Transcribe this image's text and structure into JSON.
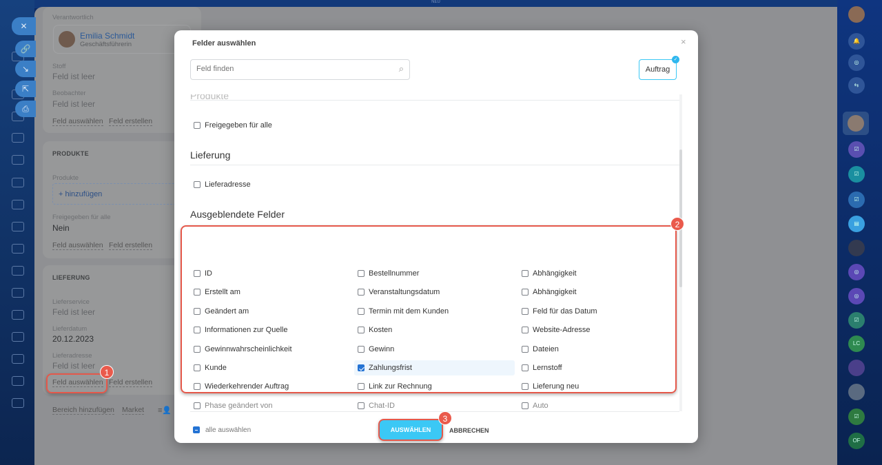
{
  "topbar": {
    "label": "NEU"
  },
  "floating_actions": [
    "close-icon",
    "link-icon",
    "download-icon",
    "external-icon",
    "print-icon"
  ],
  "detail": {
    "responsible_label": "Verantwortlich",
    "responsible_name": "Emilia Schmidt",
    "responsible_role": "Geschäftsführerin",
    "fields1": [
      {
        "label": "Stoff",
        "value": "Feld ist leer"
      },
      {
        "label": "Beobachter",
        "value": "Feld ist leer"
      }
    ],
    "select_field": "Feld auswählen",
    "create_field": "Feld erstellen",
    "products_section": "PRODUKTE",
    "products_label": "Produkte",
    "add_label": "+ hinzufügen",
    "shared_label": "Freigegeben für alle",
    "shared_value": "Nein",
    "delivery_section": "LIEFERUNG",
    "delivery_fields": [
      {
        "label": "Lieferservice",
        "value": "Feld ist leer"
      },
      {
        "label": "Lieferdatum",
        "value": "20.12.2023"
      },
      {
        "label": "Lieferadresse",
        "value": "Feld ist leer"
      }
    ],
    "add_area": "Bereich hinzufügen",
    "market": "Market"
  },
  "modal": {
    "title": "Felder auswählen",
    "search_placeholder": "Feld finden",
    "entity_button": "Auftrag",
    "cut_section": "Produkte",
    "products_items": [
      {
        "label": "Freigegeben für alle",
        "checked": false
      }
    ],
    "delivery_title": "Lieferung",
    "delivery_items": [
      {
        "label": "Lieferadresse",
        "checked": false
      }
    ],
    "hidden_title": "Ausgeblendete Felder",
    "hidden_items": [
      [
        {
          "label": "ID",
          "checked": false
        },
        {
          "label": "Bestellnummer",
          "checked": false
        },
        {
          "label": "Abhängigkeit",
          "checked": false
        }
      ],
      [
        {
          "label": "Erstellt am",
          "checked": false
        },
        {
          "label": "Veranstaltungsdatum",
          "checked": false
        },
        {
          "label": "Abhängigkeit",
          "checked": false
        }
      ],
      [
        {
          "label": "Geändert am",
          "checked": false
        },
        {
          "label": "Termin mit dem Kunden",
          "checked": false
        },
        {
          "label": "Feld für das Datum",
          "checked": false
        }
      ],
      [
        {
          "label": "Informationen zur Quelle",
          "checked": false
        },
        {
          "label": "Kosten",
          "checked": false
        },
        {
          "label": "Website-Adresse",
          "checked": false
        }
      ],
      [
        {
          "label": "Gewinnwahrscheinlichkeit",
          "checked": false
        },
        {
          "label": "Gewinn",
          "checked": false
        },
        {
          "label": "Dateien",
          "checked": false
        }
      ],
      [
        {
          "label": "Kunde",
          "checked": false
        },
        {
          "label": "Zahlungsfrist",
          "checked": true
        },
        {
          "label": "Lernstoff",
          "checked": false
        }
      ],
      [
        {
          "label": "Wiederkehrender Auftrag",
          "checked": false
        },
        {
          "label": "Link zur Rechnung",
          "checked": false
        },
        {
          "label": "Lieferung neu",
          "checked": false
        }
      ],
      [
        {
          "label": "Phase geändert von",
          "checked": false
        },
        {
          "label": "Chat-ID",
          "checked": false
        },
        {
          "label": "Auto",
          "checked": false
        }
      ]
    ],
    "select_all": "alle auswählen",
    "confirm": "AUSWÄHLEN",
    "cancel": "ABBRECHEN"
  },
  "annotations": [
    "1",
    "2",
    "3"
  ],
  "rightbar": {
    "initials": [
      "LC",
      "OF"
    ]
  },
  "colors": {
    "accent": "#3bc8f5",
    "annotation": "#e5584a",
    "checkbox": "#2473d4"
  }
}
